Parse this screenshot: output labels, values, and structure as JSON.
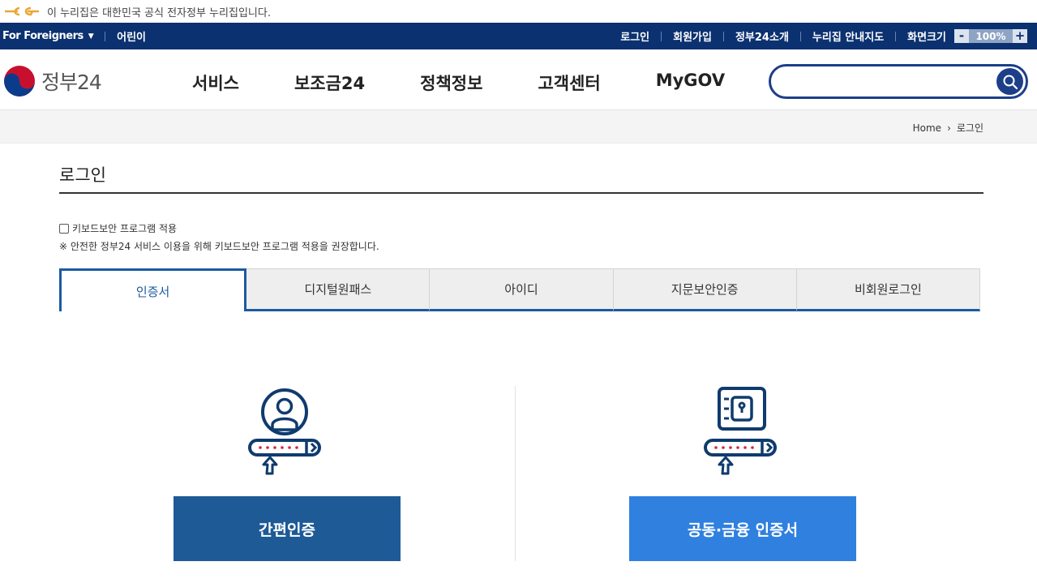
{
  "gov_notice": {
    "text": "이 누리집은 대한민국 공식 전자정부 누리집입니다."
  },
  "util_bar": {
    "foreigners": "For Foreigners",
    "kids": "어린이",
    "links": [
      "로그인",
      "회원가입",
      "정부24소개",
      "누리집 안내지도"
    ],
    "zoom_label": "화면크기",
    "zoom_minus": "-",
    "zoom_value": "100%",
    "zoom_plus": "+"
  },
  "header": {
    "logo_text": "정부24",
    "nav": [
      "서비스",
      "보조금24",
      "정책정보",
      "고객센터",
      "MyGOV"
    ],
    "search_value": "",
    "colors": {
      "brand_navy": "#0b3170",
      "accent_blue": "#1d5aa0"
    }
  },
  "breadcrumb": {
    "home": "Home",
    "current": "로그인"
  },
  "page": {
    "title": "로그인",
    "secure_checkbox_label": "키보드보안 프로그램 적용",
    "notice": "※ 안전한 정부24 서비스 이용을 위해 키보드보안 프로그램 적용을 권장합니다."
  },
  "tabs": [
    {
      "label": "인증서",
      "active": true
    },
    {
      "label": "디지털원패스",
      "active": false
    },
    {
      "label": "아이디",
      "active": false
    },
    {
      "label": "지문보안인증",
      "active": false
    },
    {
      "label": "비회원로그인",
      "active": false
    }
  ],
  "options": {
    "simple": {
      "label": "간편인증",
      "icon": "user-password-icon",
      "color": "#1d5a96"
    },
    "certificate": {
      "label": "공동·금융 인증서",
      "icon": "safe-password-icon",
      "color": "#2f80df"
    }
  }
}
